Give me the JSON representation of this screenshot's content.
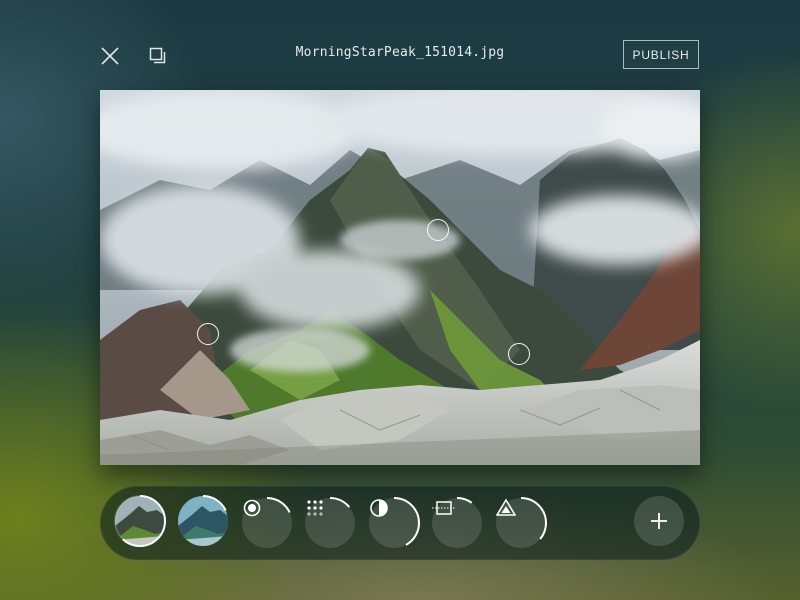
{
  "header": {
    "filename": "MorningStarPeak_151014.jpg",
    "publish_label": "PUBLISH",
    "close_icon": "close-icon",
    "duplicate_icon": "duplicate-icon"
  },
  "photo": {
    "subject": "mountain landscape with clouds",
    "hotspot_count": 3
  },
  "toolbar": {
    "tools": [
      {
        "name": "filter-thumbnail-1",
        "icon": "thumbnail",
        "progress": 0.62
      },
      {
        "name": "filter-thumbnail-2",
        "icon": "thumbnail",
        "progress": 0.18
      },
      {
        "name": "focus-tool",
        "icon": "radio-target-icon",
        "progress": 0.18
      },
      {
        "name": "grain-tool",
        "icon": "dot-grid-icon",
        "progress": 0.14
      },
      {
        "name": "contrast-tool",
        "icon": "half-circle-icon",
        "progress": 0.42
      },
      {
        "name": "crop-tool",
        "icon": "crop-frame-icon",
        "progress": 0.1
      },
      {
        "name": "sharpen-tool",
        "icon": "triangle-icon",
        "progress": 0.36
      }
    ],
    "add_icon": "plus-icon"
  },
  "colors": {
    "accent_ring": "#ffffff",
    "track": "rgba(255,255,255,0.18)"
  }
}
